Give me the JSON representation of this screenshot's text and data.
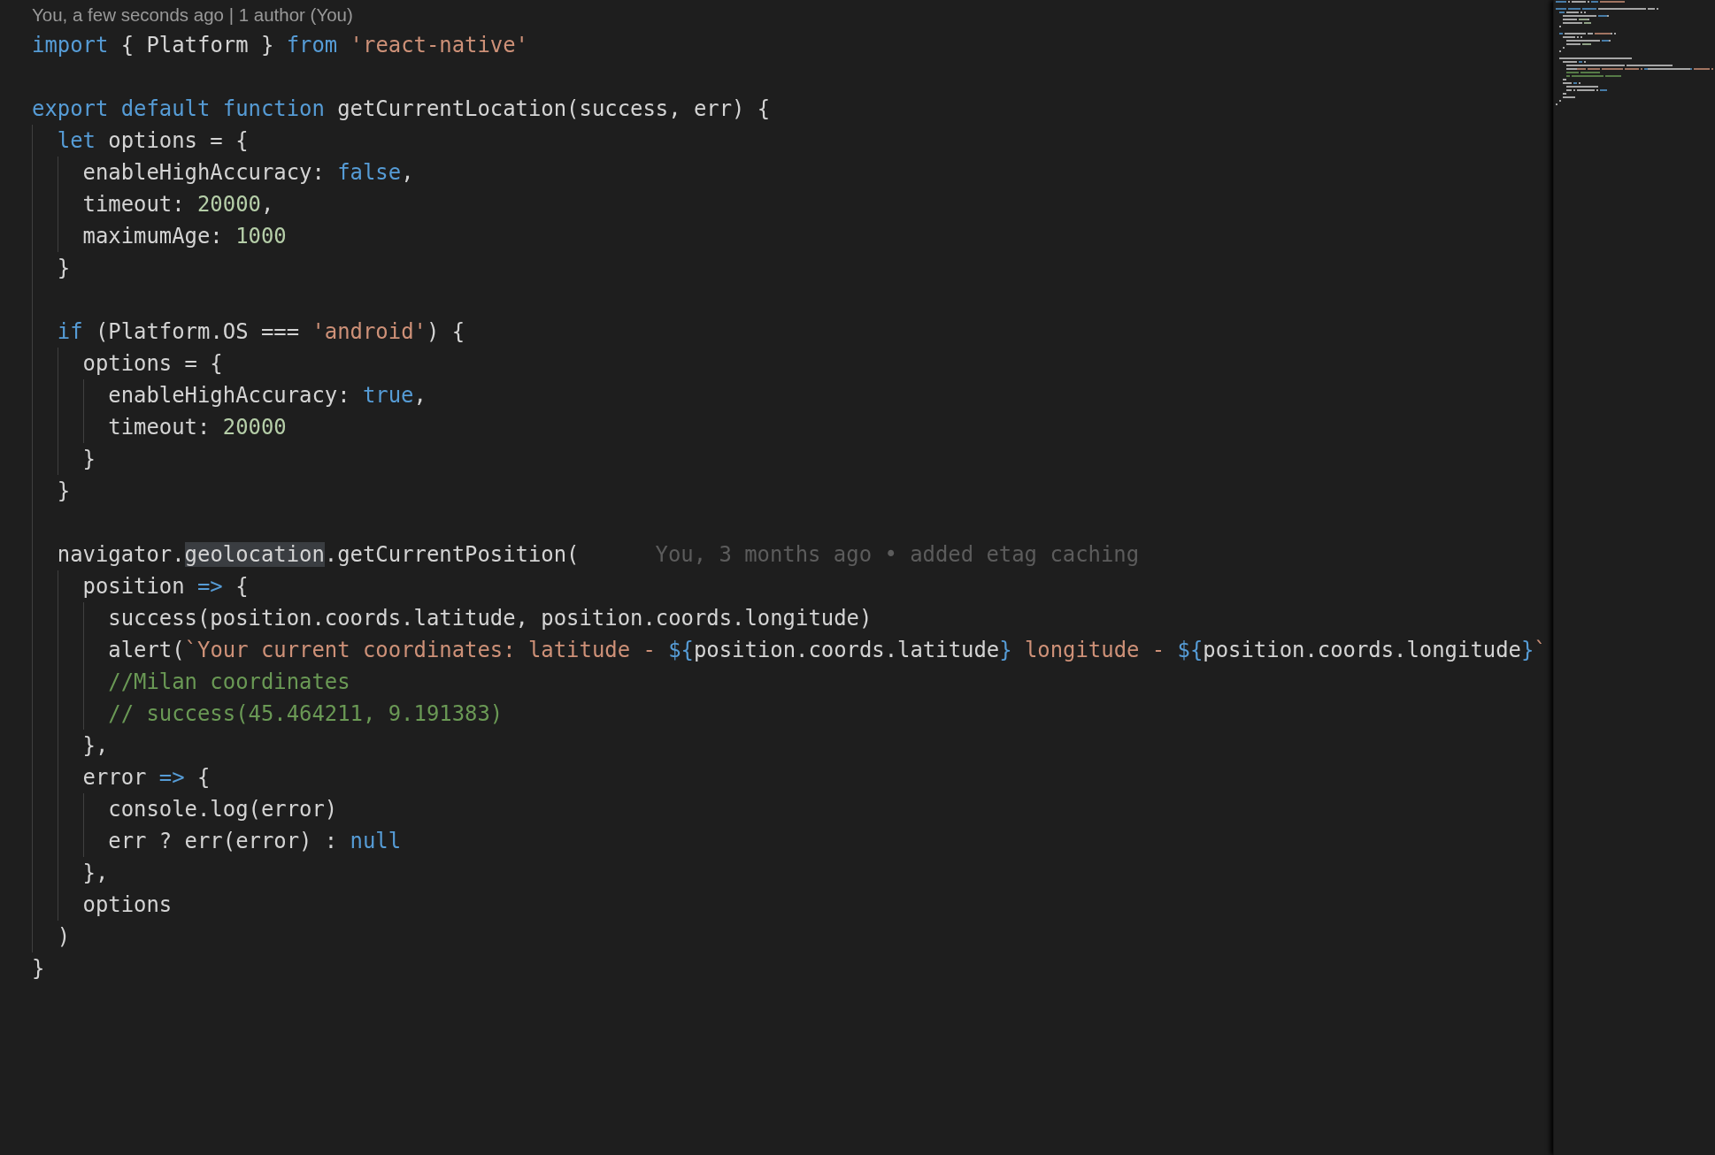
{
  "codelens": "You, a few seconds ago | 1 author (You)",
  "lines": [
    {
      "kind": "code",
      "tokens": [
        {
          "kind": "kw",
          "text": "import"
        },
        {
          "kind": "plain",
          "text": " { Platform } "
        },
        {
          "kind": "kw",
          "text": "from"
        },
        {
          "kind": "str",
          "text": " 'react-native'"
        }
      ]
    },
    {
      "kind": "blank"
    },
    {
      "kind": "code",
      "tokens": [
        {
          "kind": "kw",
          "text": "export default function"
        },
        {
          "kind": "plain",
          "text": " getCurrentLocation(success, err) {"
        }
      ],
      "children": [
        {
          "kind": "code",
          "tokens": [
            {
              "kind": "kw",
              "text": "let"
            },
            {
              "kind": "plain",
              "text": " options = {"
            }
          ],
          "children": [
            {
              "kind": "code",
              "tokens": [
                {
                  "kind": "plain",
                  "text": "enableHighAccuracy: "
                },
                {
                  "kind": "kw",
                  "text": "false"
                },
                {
                  "kind": "plain",
                  "text": ","
                }
              ]
            },
            {
              "kind": "code",
              "tokens": [
                {
                  "kind": "plain",
                  "text": "timeout: "
                },
                {
                  "kind": "num",
                  "text": "20000"
                },
                {
                  "kind": "plain",
                  "text": ","
                }
              ]
            },
            {
              "kind": "code",
              "tokens": [
                {
                  "kind": "plain",
                  "text": "maximumAge: "
                },
                {
                  "kind": "num",
                  "text": "1000"
                }
              ]
            }
          ]
        },
        {
          "kind": "code",
          "tokens": [
            {
              "kind": "plain",
              "text": "}"
            }
          ]
        },
        {
          "kind": "blank"
        },
        {
          "kind": "code",
          "tokens": [
            {
              "kind": "kw",
              "text": "if"
            },
            {
              "kind": "plain",
              "text": " (Platform.OS === "
            },
            {
              "kind": "str",
              "text": "'android'"
            },
            {
              "kind": "plain",
              "text": ") {"
            }
          ],
          "children": [
            {
              "kind": "code",
              "tokens": [
                {
                  "kind": "plain",
                  "text": "options = {"
                }
              ],
              "children": [
                {
                  "kind": "code",
                  "tokens": [
                    {
                      "kind": "plain",
                      "text": "enableHighAccuracy: "
                    },
                    {
                      "kind": "kw",
                      "text": "true"
                    },
                    {
                      "kind": "plain",
                      "text": ","
                    }
                  ]
                },
                {
                  "kind": "code",
                  "tokens": [
                    {
                      "kind": "plain",
                      "text": "timeout: "
                    },
                    {
                      "kind": "num",
                      "text": "20000"
                    }
                  ]
                }
              ]
            },
            {
              "kind": "code",
              "tokens": [
                {
                  "kind": "plain",
                  "text": "}"
                }
              ]
            }
          ]
        },
        {
          "kind": "code",
          "tokens": [
            {
              "kind": "plain",
              "text": "}"
            }
          ]
        },
        {
          "kind": "blank"
        },
        {
          "kind": "code",
          "tokens": [
            {
              "kind": "plain",
              "text": "navigator."
            },
            {
              "kind": "match",
              "text": "geolocation"
            },
            {
              "kind": "plain",
              "text": ".getCurrentPosition("
            }
          ],
          "annotation": "You, 3 months ago • added etag caching",
          "children": [
            {
              "kind": "code",
              "tokens": [
                {
                  "kind": "plain",
                  "text": "position "
                },
                {
                  "kind": "kw",
                  "text": "=>"
                },
                {
                  "kind": "plain",
                  "text": " {"
                }
              ],
              "children": [
                {
                  "kind": "code",
                  "tokens": [
                    {
                      "kind": "plain",
                      "text": "success(position.coords.latitude, position.coords.longitude)"
                    }
                  ]
                },
                {
                  "kind": "code",
                  "tokens": [
                    {
                      "kind": "plain",
                      "text": "alert("
                    },
                    {
                      "kind": "str",
                      "text": "`Your current coordinates: latitude - "
                    },
                    {
                      "kind": "kw",
                      "text": "${"
                    },
                    {
                      "kind": "plain",
                      "text": "position.coords.latitude"
                    },
                    {
                      "kind": "kw",
                      "text": "}"
                    },
                    {
                      "kind": "str",
                      "text": " longitude - "
                    },
                    {
                      "kind": "kw",
                      "text": "${"
                    },
                    {
                      "kind": "plain",
                      "text": "position.coords.longitude"
                    },
                    {
                      "kind": "kw",
                      "text": "}"
                    },
                    {
                      "kind": "str",
                      "text": "`"
                    }
                  ]
                },
                {
                  "kind": "code",
                  "tokens": [
                    {
                      "kind": "comment",
                      "text": "//Milan coordinates"
                    }
                  ]
                },
                {
                  "kind": "code",
                  "tokens": [
                    {
                      "kind": "comment",
                      "text": "// success(45.464211, 9.191383)"
                    }
                  ]
                }
              ]
            },
            {
              "kind": "code",
              "tokens": [
                {
                  "kind": "plain",
                  "text": "},"
                }
              ]
            },
            {
              "kind": "code",
              "tokens": [
                {
                  "kind": "plain",
                  "text": "error "
                },
                {
                  "kind": "kw",
                  "text": "=>"
                },
                {
                  "kind": "plain",
                  "text": " {"
                }
              ],
              "children": [
                {
                  "kind": "code",
                  "tokens": [
                    {
                      "kind": "plain",
                      "text": "console.log(error)"
                    }
                  ]
                },
                {
                  "kind": "code",
                  "tokens": [
                    {
                      "kind": "plain",
                      "text": "err ? err(error) : "
                    },
                    {
                      "kind": "kw",
                      "text": "null"
                    }
                  ]
                }
              ]
            },
            {
              "kind": "code",
              "tokens": [
                {
                  "kind": "plain",
                  "text": "},"
                }
              ]
            },
            {
              "kind": "code",
              "tokens": [
                {
                  "kind": "plain",
                  "text": "options"
                }
              ]
            }
          ]
        },
        {
          "kind": "code",
          "tokens": [
            {
              "kind": "plain",
              "text": ")"
            }
          ]
        }
      ]
    },
    {
      "kind": "code",
      "tokens": [
        {
          "kind": "plain",
          "text": "}"
        }
      ]
    }
  ]
}
